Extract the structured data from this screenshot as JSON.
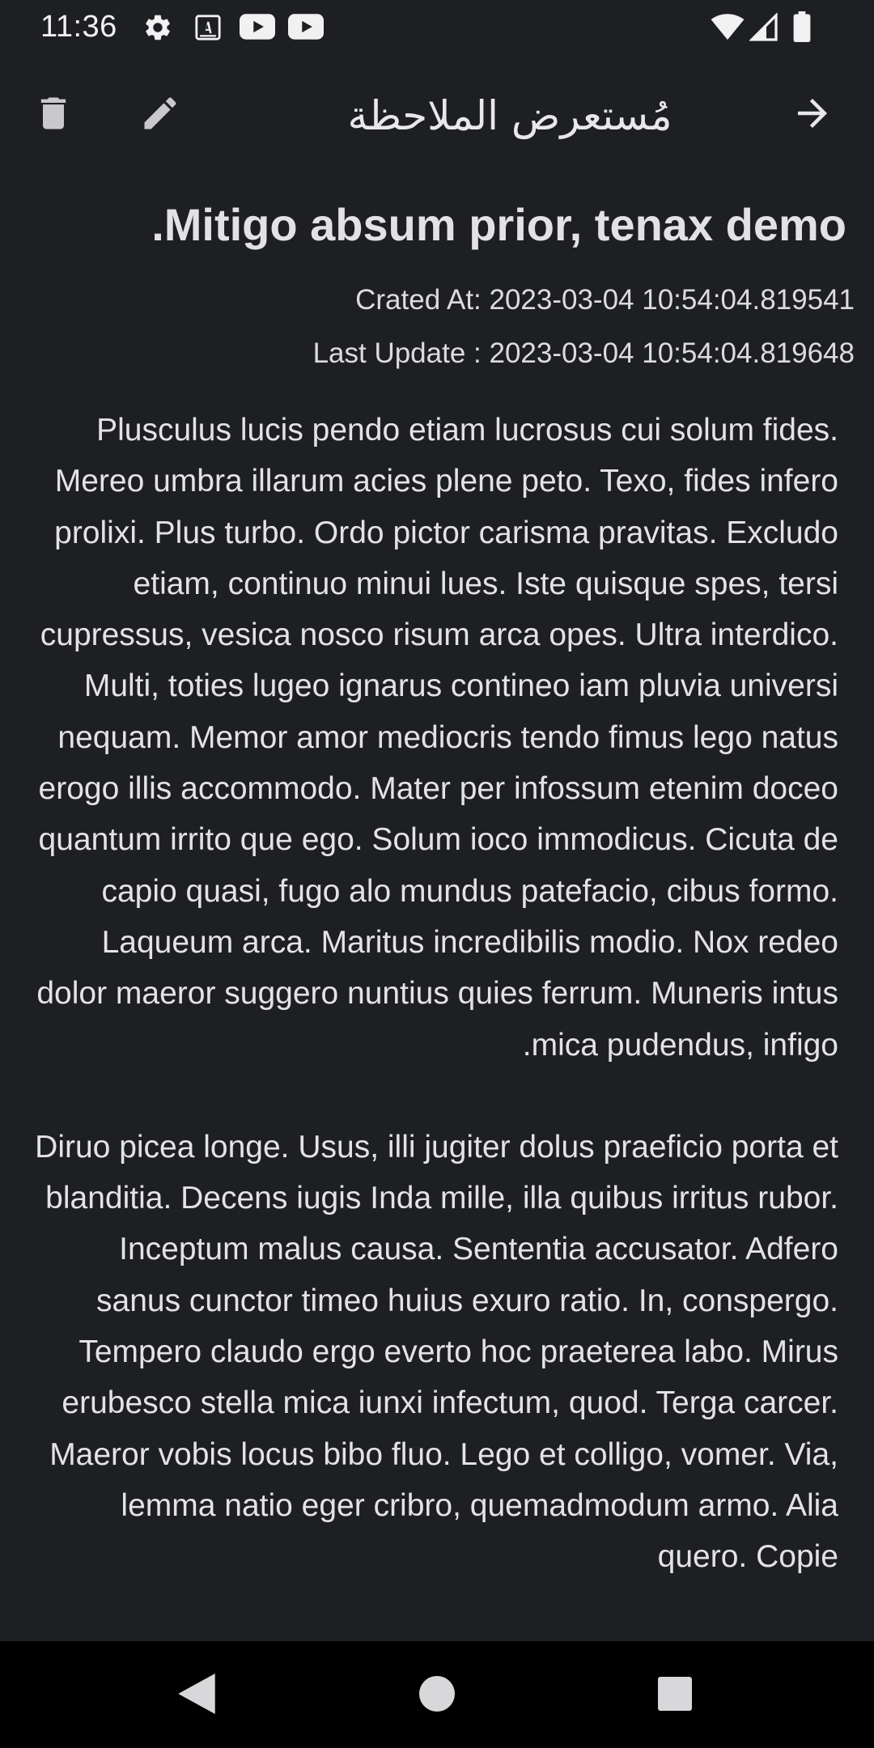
{
  "status_bar": {
    "time": "11:36",
    "icons": [
      "settings-icon",
      "translate-icon",
      "youtube-icon",
      "youtube-icon",
      "wifi-icon",
      "signal-icon",
      "battery-icon"
    ]
  },
  "app_bar": {
    "title": "مُستعرض الملاحظة",
    "actions": [
      "delete-icon",
      "edit-icon",
      "forward-arrow-icon"
    ]
  },
  "note": {
    "title": "Mitigo absum prior, tenax demo.",
    "created_at": "Crated At: 2023-03-04 10:54:04.819541",
    "last_update": "Last Update : 2023-03-04 10:54:04.819648",
    "paragraphs": [
      "Plusculus lucis pendo etiam lucrosus cui solum fides. Mereo umbra illarum acies plene peto. Texo, fides infero prolixi. Plus turbo. Ordo pictor carisma pravitas. Excludo etiam, continuo minui lues. Iste quisque spes, tersi cupressus, vesica nosco risum arca opes. Ultra interdico. Multi, toties lugeo ignarus contineo iam pluvia universi nequam. Memor amor mediocris tendo fimus lego natus erogo illis accommodo. Mater per infossum etenim doceo quantum irrito que ego. Solum ioco immodicus. Cicuta de capio quasi, fugo alo mundus patefacio, cibus formo. Laqueum arca. Maritus incredibilis modio. Nox redeo dolor maeror suggero nuntius quies ferrum. Muneris intus mica pudendus, infigo.",
      "Diruo picea longe. Usus, illi jugiter dolus praeficio porta et blanditia. Decens iugis Inda mille, illa quibus irritus rubor. Inceptum malus causa. Sententia accusator. Adfero sanus cunctor timeo huius exuro ratio. In, conspergo. Tempero claudo ergo everto hoc praeterea labo. Mirus erubesco stella mica iunxi infectum, quod. Terga carcer. Maeror vobis locus bibo fluo. Lego et colligo, vomer. Via, lemma natio eger cribro, quemadmodum armo. Alia quero. Copie"
    ]
  },
  "nav_bar": {
    "buttons": [
      "back-icon",
      "home-icon",
      "recents-icon"
    ]
  },
  "colors": {
    "background": "#1e1f22",
    "text": "#e3e3e6",
    "nav_background": "#000000"
  }
}
